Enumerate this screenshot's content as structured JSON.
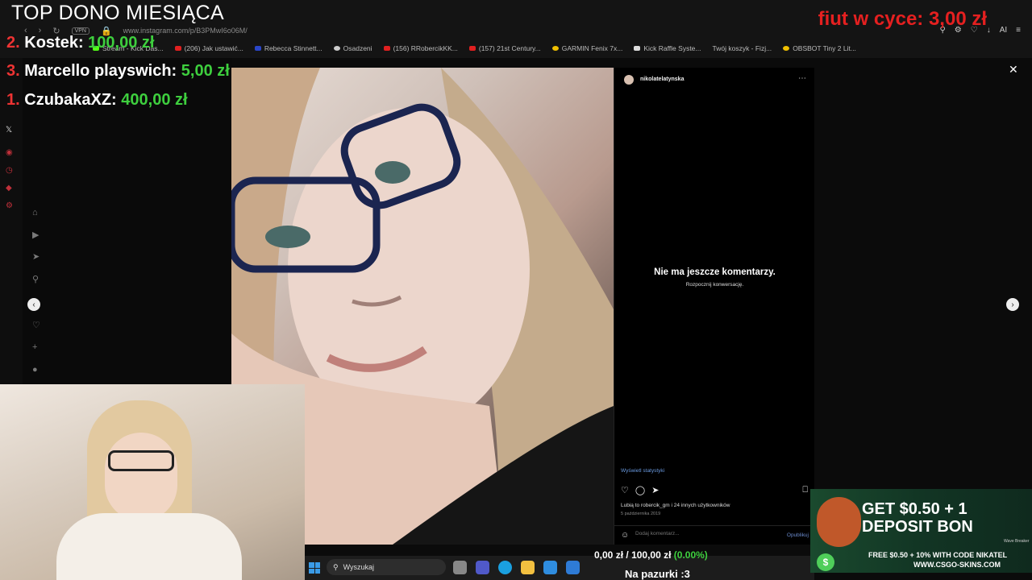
{
  "overlay": {
    "title": "TOP DONO MIESIĄCA",
    "donors": [
      {
        "rank": "2.",
        "name": "Kostek:",
        "amount": "100,00 zł"
      },
      {
        "rank": "3.",
        "name": "Marcello playswich:",
        "amount": "5,00 zł"
      },
      {
        "rank": "1.",
        "name": "CzubakaXZ:",
        "amount": "400,00 zł"
      }
    ],
    "latest_label": "fiut w cyce:",
    "latest_amount": "3,00 zł",
    "goal_current": "0,00 zł",
    "goal_sep": "/",
    "goal_target": "100,00 zł",
    "goal_percent": "(0.00%)",
    "bottom_text": "Na pazurki :3"
  },
  "browser": {
    "vpn": "VPN",
    "url": "www.instagram.com/p/B3PMwI6o06M/",
    "bookmarks": [
      "Stream - Kick Das...",
      "(206) Jak ustawić...",
      "Rebecca Stinnett...",
      "Osadzeni",
      "(156) RRobercikKK...",
      "(157) 21st Century...",
      "GARMIN Fenix 7x...",
      "Kick Raffle Syste...",
      "Twój koszyk - Fizj...",
      "OBSBOT Tiny 2 Lit..."
    ],
    "tools_ai": "AI"
  },
  "post": {
    "username": "nikolatelatynska",
    "no_comments": "Nie ma jeszcze komentarzy.",
    "start_conversation": "Rozpocznij konwersację.",
    "view_stats": "Wyświetl statystyki",
    "likes": "Lubią to robercik_gm i 24 innych użytkowników",
    "date": "5 października 2019",
    "comment_placeholder": "Dodaj komentarz...",
    "publish": "Opublikuj"
  },
  "taskbar": {
    "search_placeholder": "Wyszukaj"
  },
  "ad": {
    "headline_1": "GET $0.50 + 1",
    "headline_2": "DEPOSIT BON",
    "line_1": "FREE $0.50 + 10% WITH CODE NIKATEL",
    "line_2": "WWW.CSGO-SKINS.COM",
    "brand": "Wave Breaker"
  },
  "colors": {
    "donor_rank": "#e33333",
    "donor_amount": "#3ecf3e",
    "latest": "#e52020",
    "instagram_link": "#6a9ae0"
  }
}
